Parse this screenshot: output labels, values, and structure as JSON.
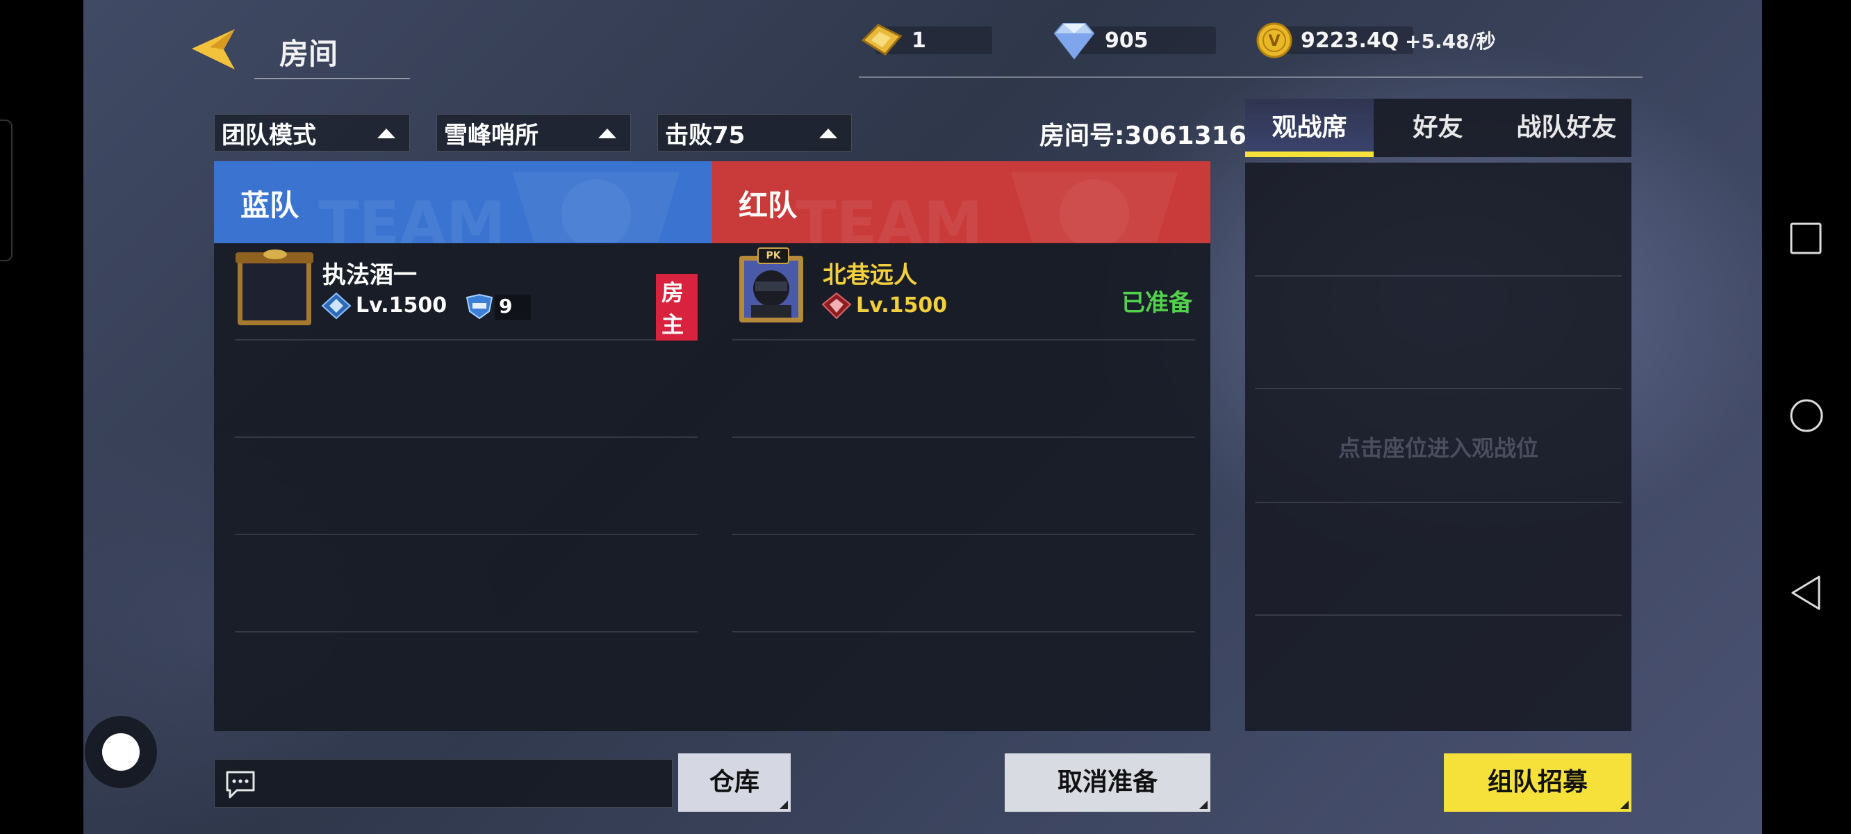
{
  "header": {
    "title": "房间",
    "resources": [
      {
        "icon": "ticket-icon",
        "value": "1"
      },
      {
        "icon": "diamond-icon",
        "value": "905"
      },
      {
        "icon": "coin-icon",
        "value": "9223.4Q"
      }
    ],
    "rate": "+5.48/秒"
  },
  "filters": {
    "mode": "团队模式",
    "map": "雪峰哨所",
    "target": "击败75"
  },
  "room_number": "房间号:3061316",
  "teams": {
    "blue": {
      "name": "蓝队",
      "color": "#3a74d0"
    },
    "red": {
      "name": "红队",
      "color": "#c93a3a"
    }
  },
  "players": {
    "blue_host": {
      "name": "执法酒一",
      "level": "Lv.1500",
      "rank_value": "9",
      "badge": "房主"
    },
    "red_player": {
      "name": "北巷远人",
      "level": "Lv.1500",
      "status": "已准备"
    }
  },
  "spectator": {
    "tabs": [
      "观战席",
      "好友",
      "战队好友"
    ],
    "active_tab": 0,
    "hint": "点击座位进入观战位"
  },
  "buttons": {
    "warehouse": "仓库",
    "cancel_ready": "取消准备",
    "recruit": "组队招募"
  },
  "colors": {
    "accent_yellow": "#f6e13a",
    "ready_green": "#52d24c",
    "host_red": "#d9233e",
    "gold_text": "#f2cf3c"
  }
}
